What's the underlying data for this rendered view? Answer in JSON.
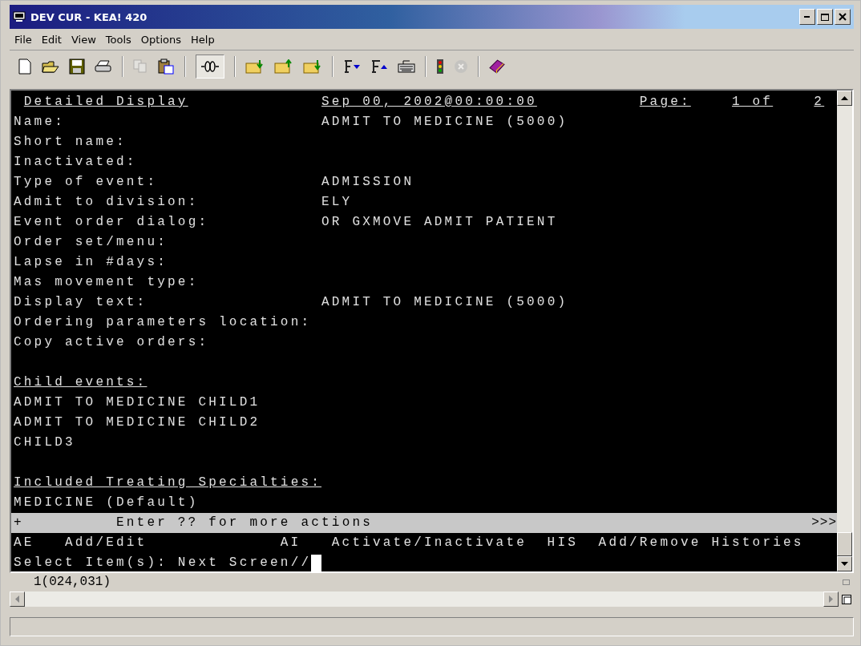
{
  "window": {
    "title": "DEV CUR - KEA! 420"
  },
  "menu": [
    {
      "label": "File"
    },
    {
      "label": "Edit"
    },
    {
      "label": "View"
    },
    {
      "label": "Tools"
    },
    {
      "label": "Options"
    },
    {
      "label": "Help"
    }
  ],
  "terminal": {
    "header": {
      "title": "Detailed Display",
      "date": "Sep 00, 2002@00:00:00",
      "page_label": "Page:",
      "page_of": "1 of",
      "page_total": "2"
    },
    "fields": [
      {
        "label": "Name:",
        "value": "ADMIT TO MEDICINE (5000)"
      },
      {
        "label": "Short name:"
      },
      {
        "label": "Inactivated:"
      },
      {
        "label": "Type of event:",
        "value": "ADMISSION"
      },
      {
        "label": "Admit to division:",
        "value": "ELY"
      },
      {
        "label": "Event order dialog:",
        "value": "OR GXMOVE ADMIT PATIENT"
      },
      {
        "label": "Order set/menu:"
      },
      {
        "label": "Lapse in #days:"
      },
      {
        "label": "Mas movement type:"
      },
      {
        "label": "Display text:",
        "value": "ADMIT TO MEDICINE (5000)"
      },
      {
        "label": "Ordering parameters location:"
      },
      {
        "label": "Copy active orders:"
      }
    ],
    "sections": [
      {
        "heading": "Child events:",
        "lines": [
          "ADMIT TO MEDICINE CHILD1",
          "ADMIT TO MEDICINE CHILD2",
          "CHILD3"
        ]
      },
      {
        "heading": "Included Treating Specialties:",
        "lines": [
          "MEDICINE (Default)"
        ]
      }
    ],
    "action_bar": {
      "marker": "+",
      "hint": "Enter ?? for more actions",
      "more": ">>>"
    },
    "actions": [
      {
        "code": "AE",
        "label": "Add/Edit"
      },
      {
        "code": "AI",
        "label": "Activate/Inactivate"
      },
      {
        "code": "HIS",
        "label": "Add/Remove Histories"
      }
    ],
    "prompt": "Select Item(s): Next Screen//"
  },
  "cursor_position": "1(024,031)"
}
